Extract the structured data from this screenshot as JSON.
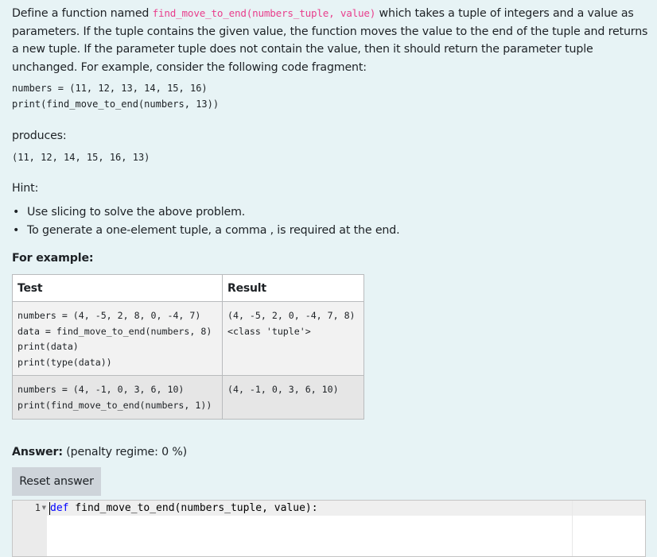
{
  "question": {
    "intro_before": "Define a function named ",
    "function_signature": "find_move_to_end(numbers_tuple, value)",
    "intro_after": " which takes a tuple of integers and a value as parameters. If the tuple contains the given value, the function moves the value to the end of the tuple and returns a new tuple. If the parameter tuple does not contain the value, then it should return the parameter tuple unchanged. For example, consider the following code fragment:",
    "code_example": "numbers = (11, 12, 13, 14, 15, 16)\nprint(find_move_to_end(numbers, 13))",
    "produces_label": "produces:",
    "output_example": "(11, 12, 14, 15, 16, 13)",
    "hint_label": "Hint:",
    "hints": [
      "Use slicing to solve the above problem.",
      "To generate a one-element tuple, a comma , is required at the end."
    ],
    "for_example_label": "For example:"
  },
  "examples_table": {
    "headers": [
      "Test",
      "Result"
    ],
    "rows": [
      {
        "test": "numbers = (4, -5, 2, 8, 0, -4, 7)\ndata = find_move_to_end(numbers, 8)\nprint(data)\nprint(type(data))",
        "result": "(4, -5, 2, 0, -4, 7, 8)\n<class 'tuple'>"
      },
      {
        "test": "numbers = (4, -1, 0, 3, 6, 10)\nprint(find_move_to_end(numbers, 1))",
        "result": "(4, -1, 0, 3, 6, 10)"
      }
    ]
  },
  "answer": {
    "label": "Answer:",
    "penalty": "(penalty regime: 0 %)",
    "reset_button": "Reset answer"
  },
  "editor": {
    "line_number": "1",
    "keyword": "def",
    "code_rest": " find_move_to_end(numbers_tuple, value):"
  },
  "colors": {
    "page_background": "#e7f3f5",
    "inline_code": "#e83e8c",
    "keyword": "#0000ff",
    "button_background": "#ced4da"
  }
}
